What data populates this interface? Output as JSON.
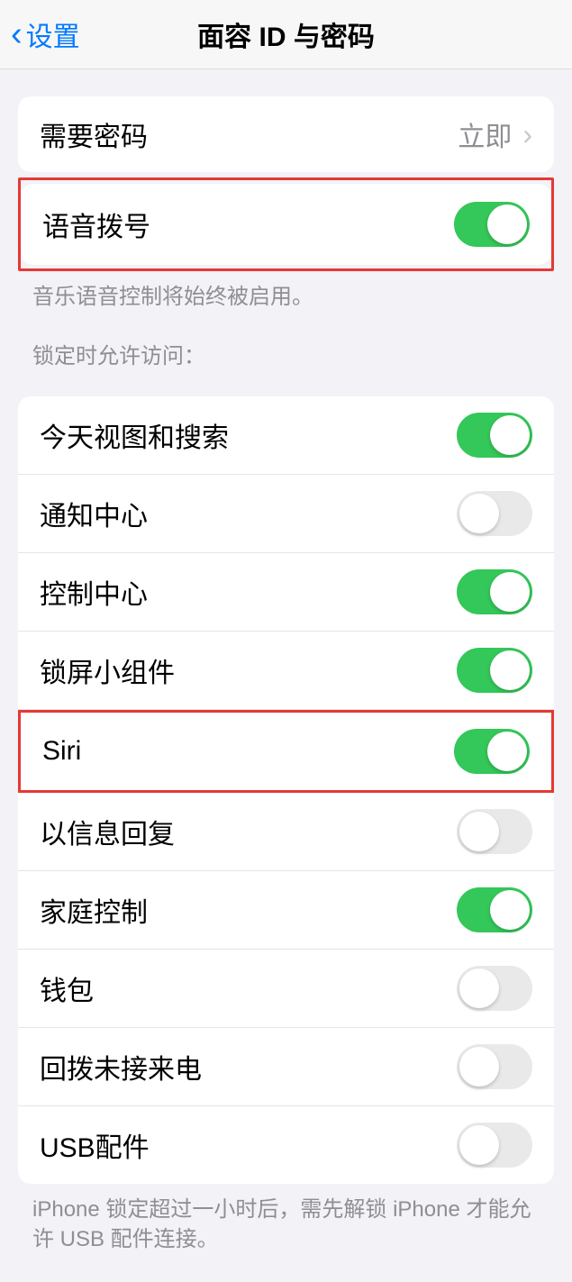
{
  "header": {
    "back_label": "设置",
    "title": "面容 ID 与密码"
  },
  "require_passcode": {
    "label": "需要密码",
    "value": "立即"
  },
  "voice_dial": {
    "label": "语音拨号",
    "enabled": true,
    "footer": "音乐语音控制将始终被启用。"
  },
  "lockscreen": {
    "section_title": "锁定时允许访问：",
    "items": [
      {
        "label": "今天视图和搜索",
        "enabled": true,
        "highlighted": false
      },
      {
        "label": "通知中心",
        "enabled": false,
        "highlighted": false
      },
      {
        "label": "控制中心",
        "enabled": true,
        "highlighted": false
      },
      {
        "label": "锁屏小组件",
        "enabled": true,
        "highlighted": false
      },
      {
        "label": "Siri",
        "enabled": true,
        "highlighted": true
      },
      {
        "label": "以信息回复",
        "enabled": false,
        "highlighted": false
      },
      {
        "label": "家庭控制",
        "enabled": true,
        "highlighted": false
      },
      {
        "label": "钱包",
        "enabled": false,
        "highlighted": false
      },
      {
        "label": "回拨未接来电",
        "enabled": false,
        "highlighted": false
      },
      {
        "label": "USB配件",
        "enabled": false,
        "highlighted": false
      }
    ],
    "footer": "iPhone 锁定超过一小时后，需先解锁 iPhone 才能允许 USB 配件连接。"
  }
}
